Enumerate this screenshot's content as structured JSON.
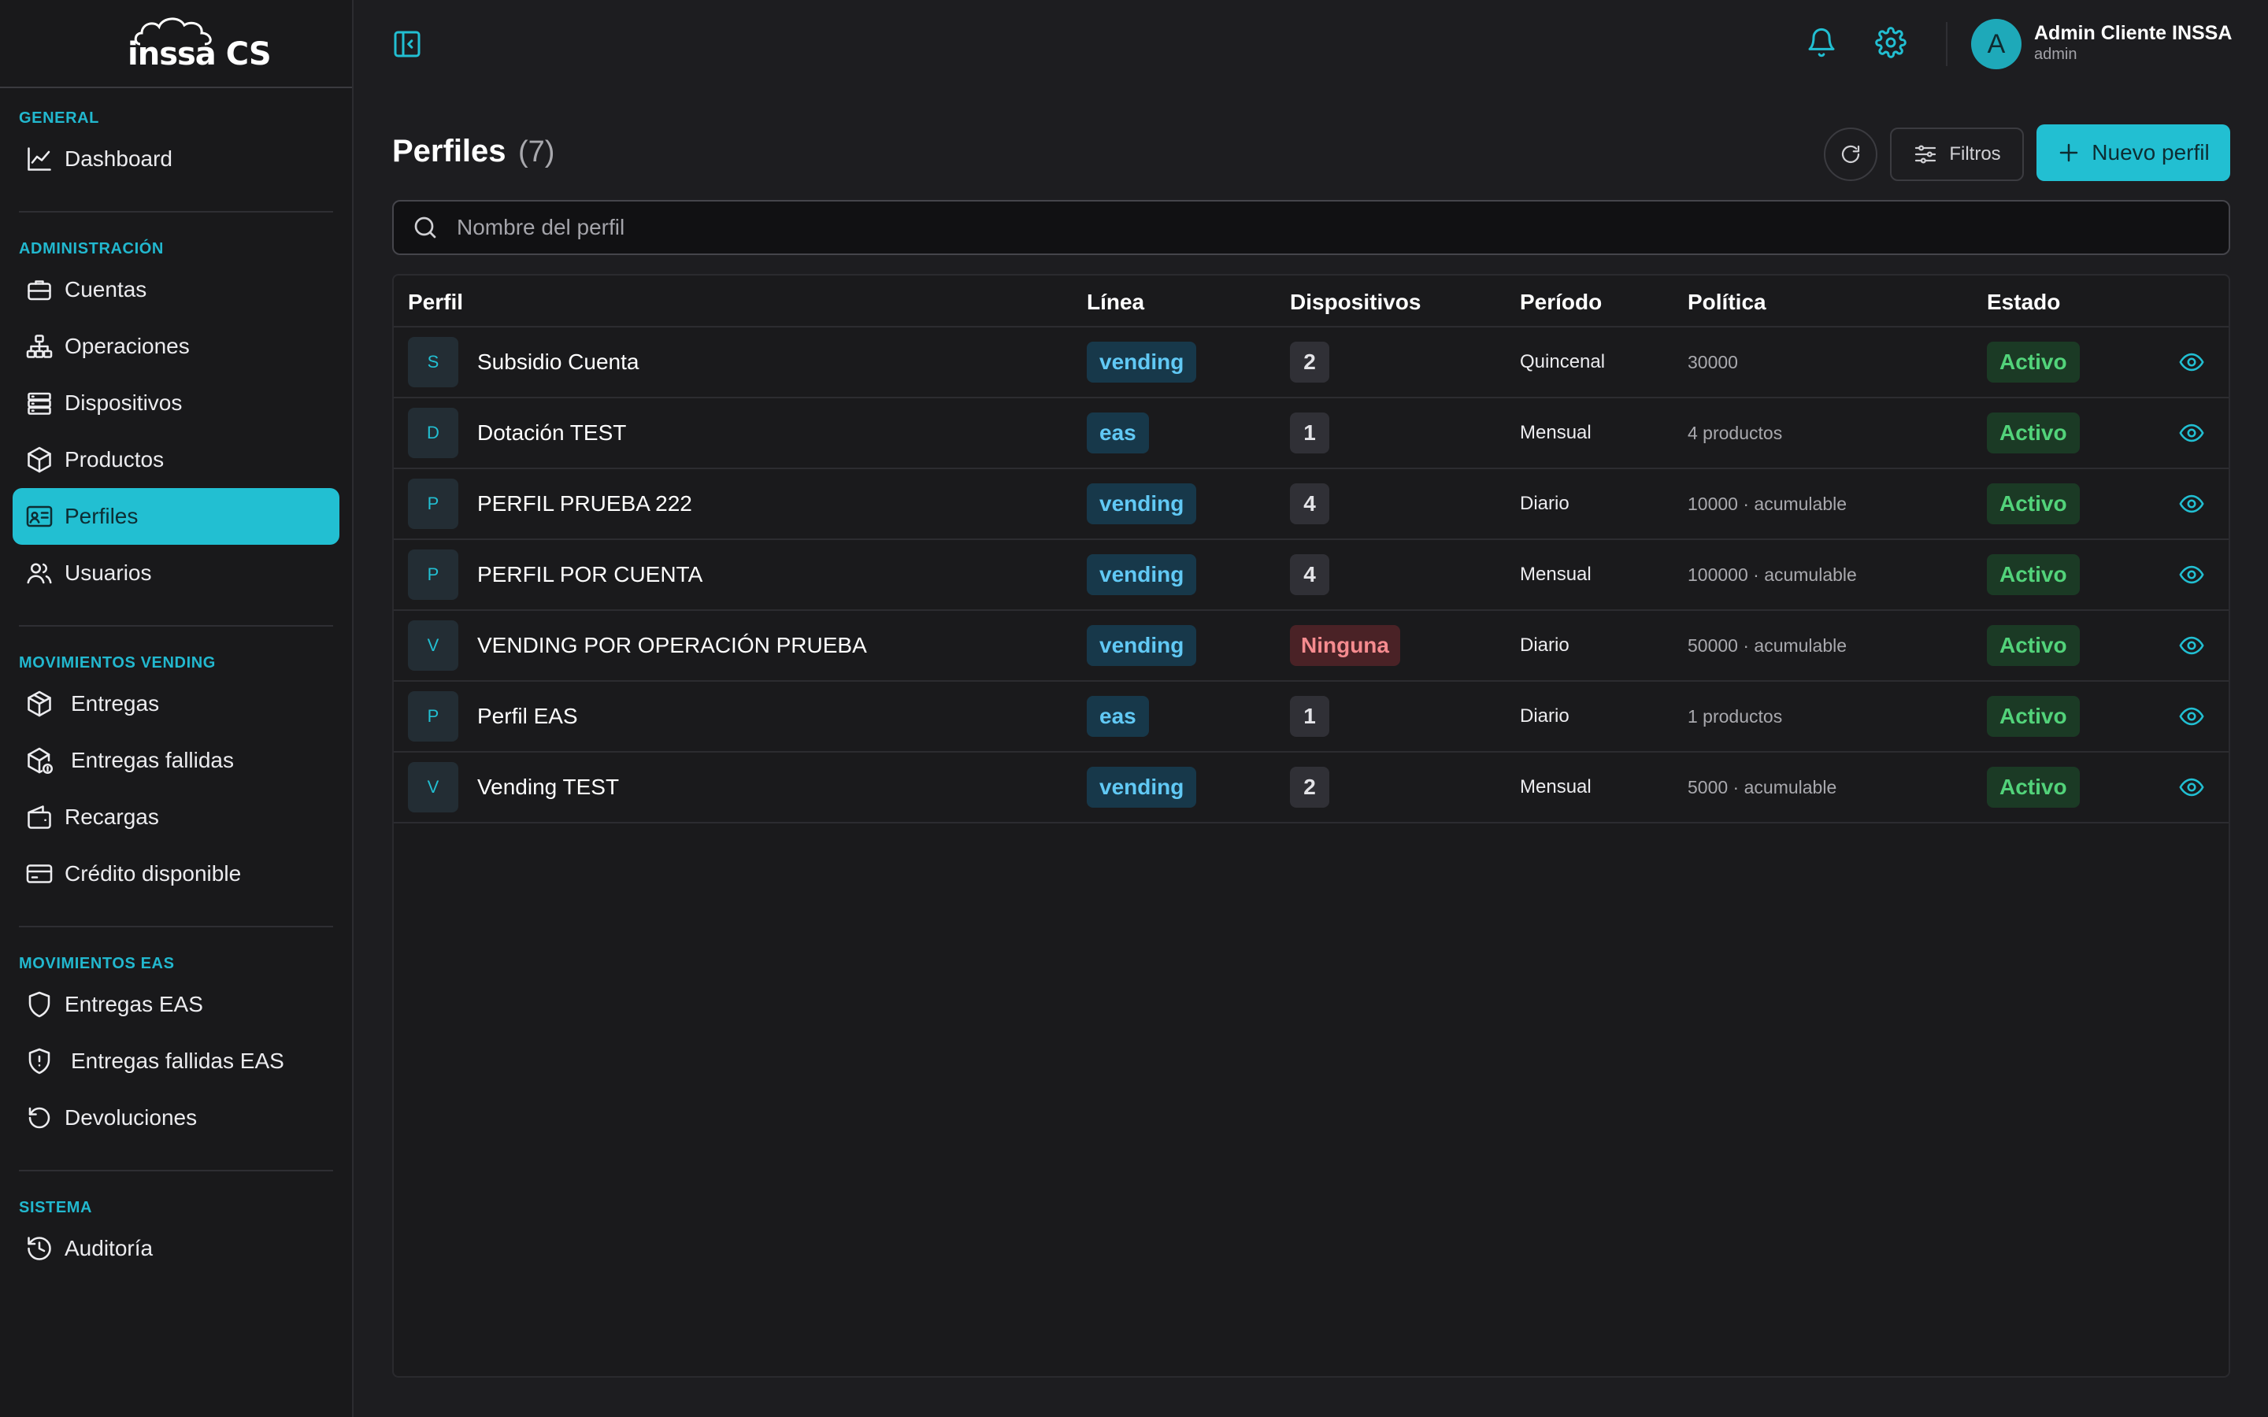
{
  "app": {
    "logo_text": "inssa CS",
    "accent": "#22bfd2"
  },
  "sidebar": {
    "sections": [
      {
        "title": "GENERAL",
        "items": [
          {
            "label": "Dashboard",
            "icon": "chart-line-icon"
          }
        ]
      },
      {
        "title": "ADMINISTRACIÓN",
        "items": [
          {
            "label": "Cuentas",
            "icon": "briefcase-icon"
          },
          {
            "label": "Operaciones",
            "icon": "org-chart-icon"
          },
          {
            "label": "Dispositivos",
            "icon": "server-icon"
          },
          {
            "label": "Productos",
            "icon": "box-icon"
          },
          {
            "label": "Perfiles",
            "icon": "id-card-icon",
            "active": true
          },
          {
            "label": "Usuarios",
            "icon": "users-icon"
          }
        ]
      },
      {
        "title": "MOVIMIENTOS VENDING",
        "items": [
          {
            "label": "Entregas",
            "icon": "package-icon"
          },
          {
            "label": "Entregas fallidas",
            "icon": "package-alert-icon"
          },
          {
            "label": "Recargas",
            "icon": "wallet-icon"
          },
          {
            "label": "Crédito disponible",
            "icon": "credit-card-icon"
          }
        ]
      },
      {
        "title": "MOVIMIENTOS EAS",
        "items": [
          {
            "label": "Entregas EAS",
            "icon": "shield-icon"
          },
          {
            "label": "Entregas fallidas EAS",
            "icon": "shield-alert-icon"
          },
          {
            "label": "Devoluciones",
            "icon": "undo-icon"
          }
        ]
      },
      {
        "title": "SISTEMA",
        "items": [
          {
            "label": "Auditoría",
            "icon": "history-icon"
          }
        ]
      }
    ]
  },
  "topbar": {
    "user_initial": "A",
    "user_name": "Admin Cliente INSSA",
    "user_role": "admin"
  },
  "header": {
    "title": "Perfiles",
    "count": "(7)",
    "filters_label": "Filtros",
    "new_label": "Nuevo perfil"
  },
  "search": {
    "placeholder": "Nombre del perfil",
    "value": ""
  },
  "table": {
    "columns": {
      "perfil": "Perfil",
      "linea": "Línea",
      "dispositivos": "Dispositivos",
      "periodo": "Período",
      "politica": "Política",
      "estado": "Estado"
    },
    "rows": [
      {
        "initial": "S",
        "name": "Subsidio Cuenta",
        "linea": "vending",
        "dispositivos": "2",
        "periodo": "Quincenal",
        "politica": "30000",
        "estado": "Activo"
      },
      {
        "initial": "D",
        "name": "Dotación TEST",
        "linea": "eas",
        "dispositivos": "1",
        "periodo": "Mensual",
        "politica": "4 productos",
        "estado": "Activo"
      },
      {
        "initial": "P",
        "name": "PERFIL PRUEBA 222",
        "linea": "vending",
        "dispositivos": "4",
        "periodo": "Diario",
        "politica": "10000 · acumulable",
        "estado": "Activo"
      },
      {
        "initial": "P",
        "name": "PERFIL POR CUENTA",
        "linea": "vending",
        "dispositivos": "4",
        "periodo": "Mensual",
        "politica": "100000 · acumulable",
        "estado": "Activo"
      },
      {
        "initial": "V",
        "name": "VENDING POR OPERACIÓN PRUEBA",
        "linea": "vending",
        "dispositivos": "Ninguna",
        "periodo": "Diario",
        "politica": "50000 · acumulable",
        "estado": "Activo"
      },
      {
        "initial": "P",
        "name": "Perfil EAS",
        "linea": "eas",
        "dispositivos": "1",
        "periodo": "Diario",
        "politica": "1 productos",
        "estado": "Activo"
      },
      {
        "initial": "V",
        "name": "Vending TEST",
        "linea": "vending",
        "dispositivos": "2",
        "periodo": "Mensual",
        "politica": "5000 · acumulable",
        "estado": "Activo"
      }
    ]
  }
}
